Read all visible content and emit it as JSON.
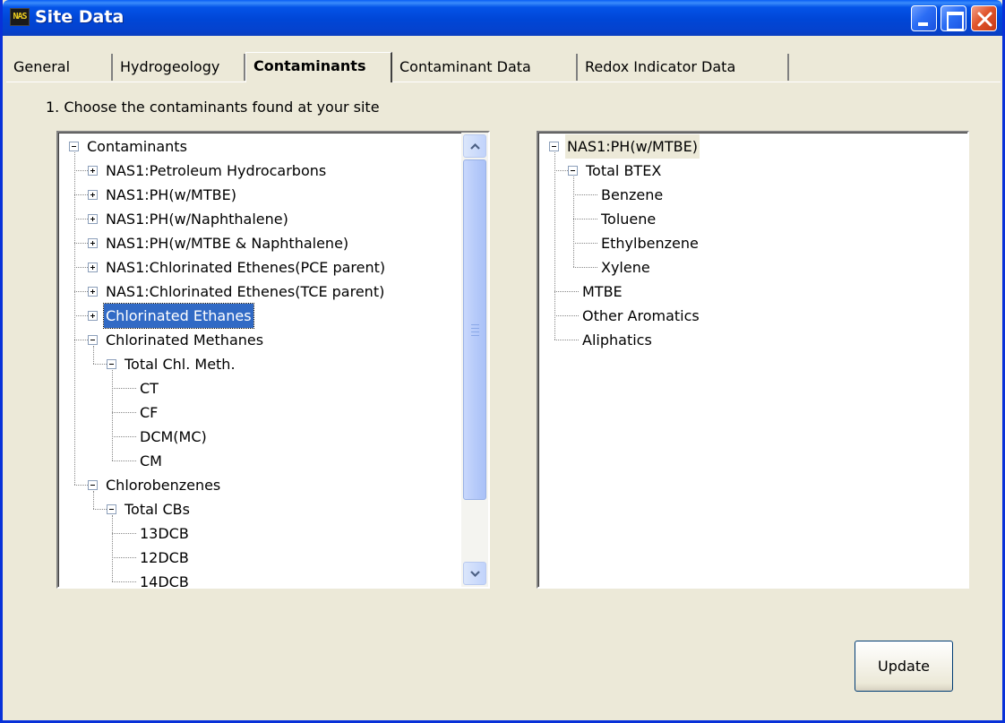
{
  "window": {
    "title": "Site Data",
    "app_icon_text": "NAS"
  },
  "tabs": [
    {
      "label": "General",
      "active": false
    },
    {
      "label": "Hydrogeology",
      "active": false
    },
    {
      "label": "Contaminants",
      "active": true
    },
    {
      "label": "Contaminant Data",
      "active": false
    },
    {
      "label": "Redox Indicator Data",
      "active": false
    }
  ],
  "instruction": "1. Choose the contaminants found at your site",
  "left_tree": {
    "nodes": [
      {
        "label": "Contaminants",
        "level": 0,
        "expander": "minus"
      },
      {
        "label": "NAS1:Petroleum Hydrocarbons",
        "level": 1,
        "expander": "plus"
      },
      {
        "label": "NAS1:PH(w/MTBE)",
        "level": 1,
        "expander": "plus"
      },
      {
        "label": "NAS1:PH(w/Naphthalene)",
        "level": 1,
        "expander": "plus"
      },
      {
        "label": "NAS1:PH(w/MTBE & Naphthalene)",
        "level": 1,
        "expander": "plus"
      },
      {
        "label": "NAS1:Chlorinated Ethenes(PCE parent)",
        "level": 1,
        "expander": "plus"
      },
      {
        "label": "NAS1:Chlorinated Ethenes(TCE parent)",
        "level": 1,
        "expander": "plus"
      },
      {
        "label": "Chlorinated Ethanes",
        "level": 1,
        "expander": "plus",
        "selected": true
      },
      {
        "label": "Chlorinated Methanes",
        "level": 1,
        "expander": "minus"
      },
      {
        "label": "Total Chl. Meth.",
        "level": 2,
        "expander": "minus"
      },
      {
        "label": "CT",
        "level": 3,
        "expander": "none"
      },
      {
        "label": "CF",
        "level": 3,
        "expander": "none"
      },
      {
        "label": "DCM(MC)",
        "level": 3,
        "expander": "none"
      },
      {
        "label": "CM",
        "level": 3,
        "expander": "none"
      },
      {
        "label": "Chlorobenzenes",
        "level": 1,
        "expander": "minus"
      },
      {
        "label": "Total CBs",
        "level": 2,
        "expander": "minus"
      },
      {
        "label": "13DCB",
        "level": 3,
        "expander": "none"
      },
      {
        "label": "12DCB",
        "level": 3,
        "expander": "none"
      },
      {
        "label": "14DCB",
        "level": 3,
        "expander": "none"
      }
    ]
  },
  "right_tree": {
    "nodes": [
      {
        "label": "NAS1:PH(w/MTBE)",
        "level": 0,
        "expander": "minus",
        "highlight": true
      },
      {
        "label": "Total BTEX",
        "level": 1,
        "expander": "minus"
      },
      {
        "label": "Benzene",
        "level": 2,
        "expander": "none"
      },
      {
        "label": "Toluene",
        "level": 2,
        "expander": "none"
      },
      {
        "label": "Ethylbenzene",
        "level": 2,
        "expander": "none"
      },
      {
        "label": "Xylene",
        "level": 2,
        "expander": "none"
      },
      {
        "label": "MTBE",
        "level": 1,
        "expander": "none"
      },
      {
        "label": "Other Aromatics",
        "level": 1,
        "expander": "none"
      },
      {
        "label": "Aliphatics",
        "level": 1,
        "expander": "none"
      }
    ]
  },
  "update_button": {
    "label": "Update"
  }
}
